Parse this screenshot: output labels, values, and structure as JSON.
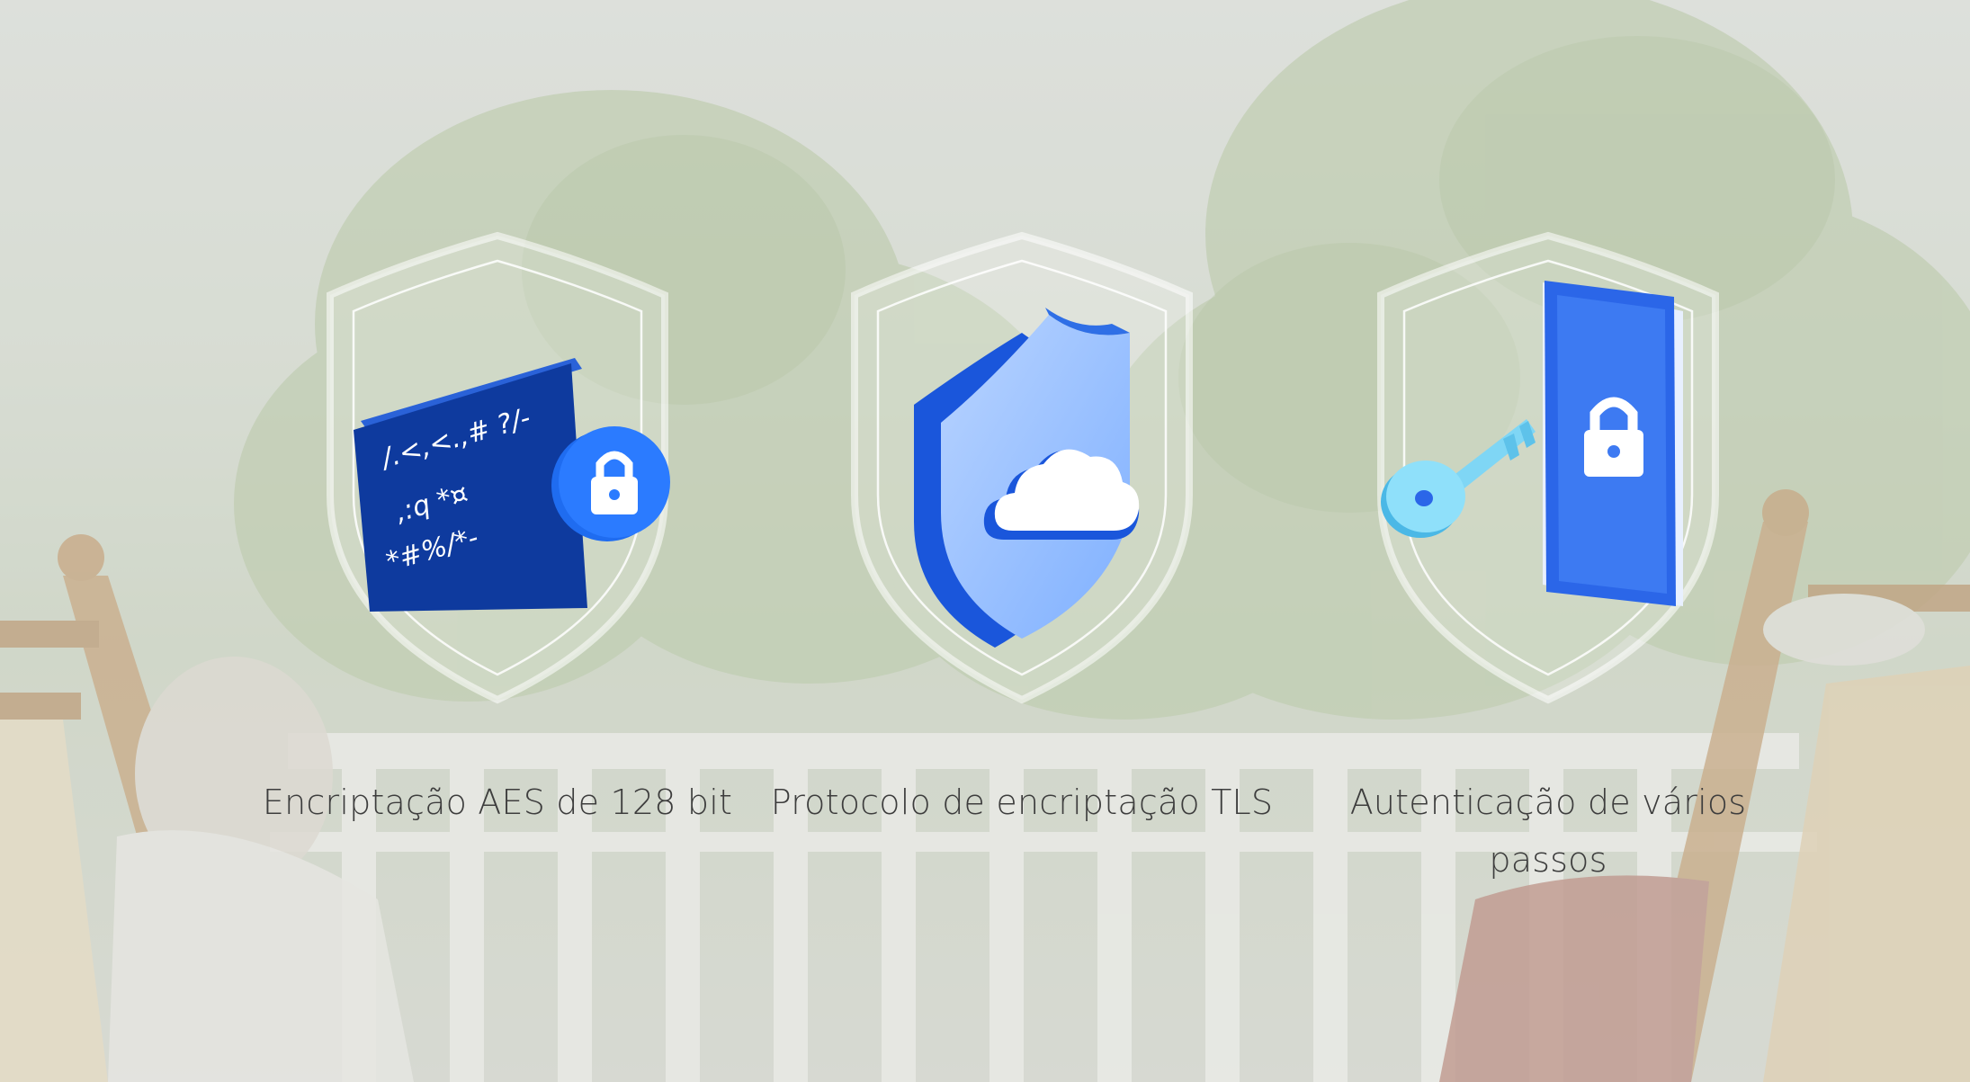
{
  "background": {
    "description_icon": "porch-rocking-chairs-photo",
    "tint": "#e2e4e0"
  },
  "features": [
    {
      "icon": "aes-encryption-icon",
      "code_lines": [
        "/.<,<.,# ?/-",
        ",:q *¤",
        "*#%/*-"
      ],
      "label": "Encriptação AES de 128 bit"
    },
    {
      "icon": "tls-cloud-shield-icon",
      "label": "Protocolo de encriptação TLS"
    },
    {
      "icon": "key-phone-lock-icon",
      "label": "Autenticação de vários passos"
    }
  ],
  "colors": {
    "brand_blue": "#1a56db",
    "dark_blue": "#0e3a9e",
    "light_blue": "#5aa2f0",
    "label_text": "#3d3d3d"
  }
}
